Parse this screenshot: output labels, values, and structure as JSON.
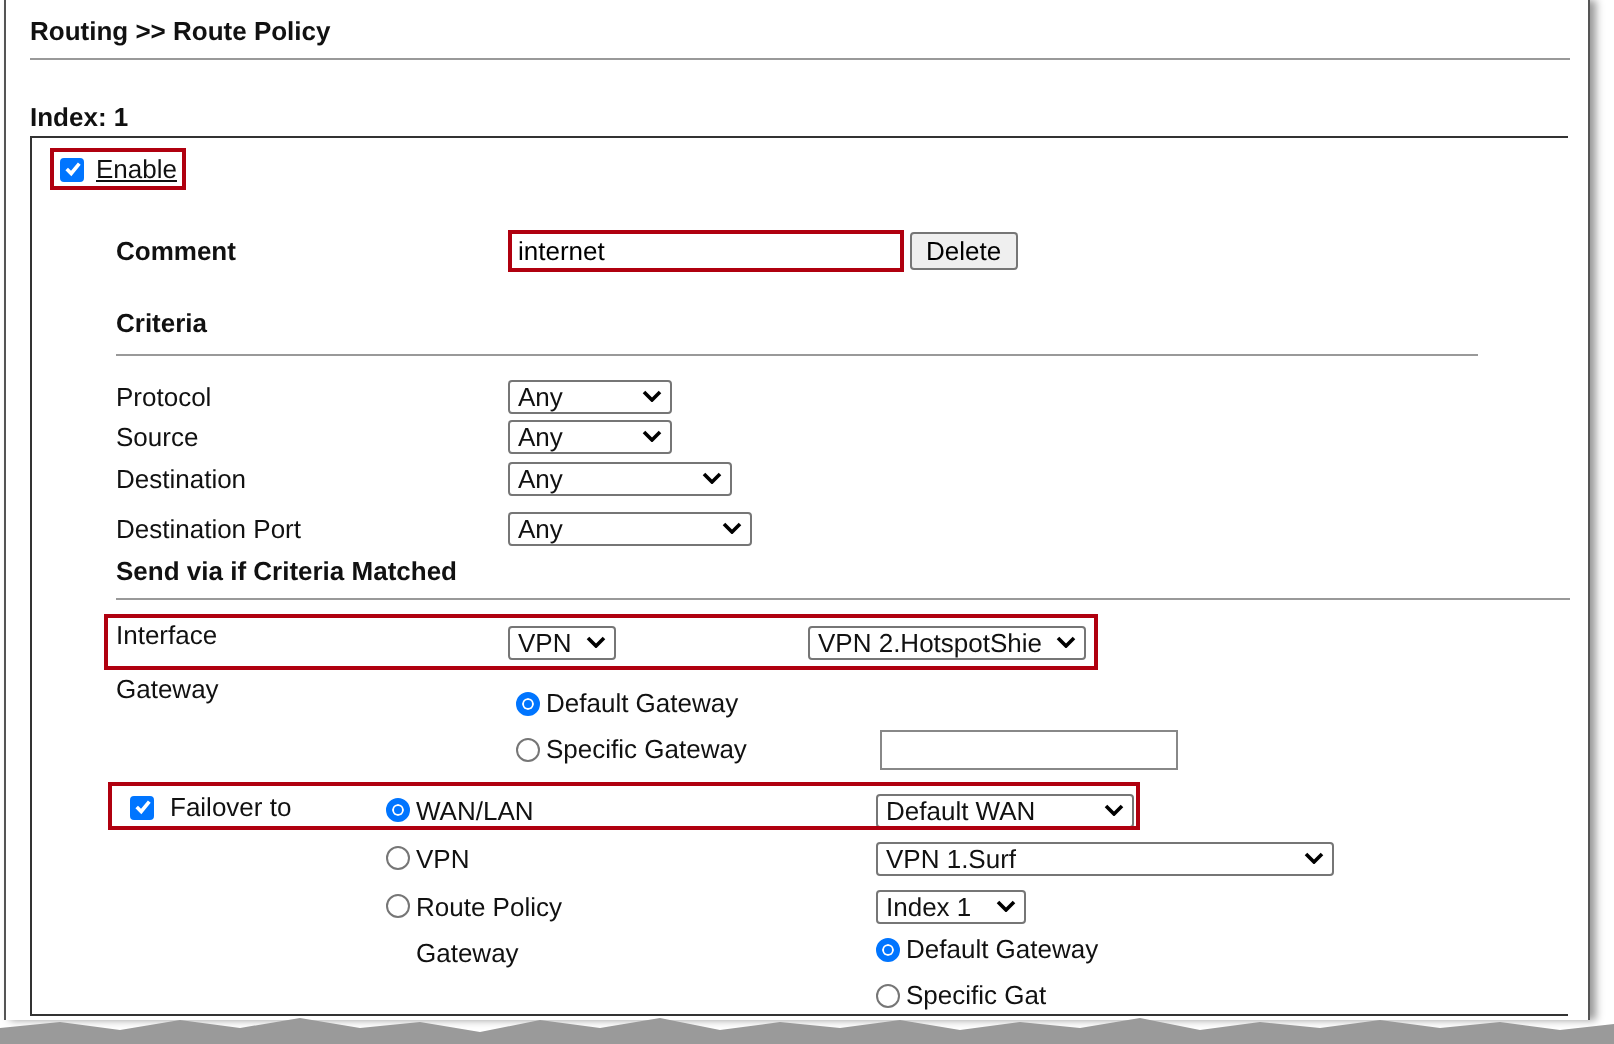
{
  "breadcrumb": "Routing >> Route Policy",
  "index_label": "Index: 1",
  "enable": {
    "label": "Enable",
    "checked": true,
    "highlighted": true
  },
  "comment": {
    "label": "Comment",
    "value": "internet",
    "button": "Delete",
    "highlighted": true
  },
  "criteria": {
    "heading": "Criteria",
    "fields": [
      {
        "label": "Protocol",
        "value": "Any"
      },
      {
        "label": "Source",
        "value": "Any"
      },
      {
        "label": "Destination",
        "value": "Any"
      },
      {
        "label": "Destination Port",
        "value": "Any"
      }
    ]
  },
  "send_via": {
    "heading": "Send via if Criteria Matched",
    "interface": {
      "label": "Interface",
      "type": "VPN",
      "target": "VPN 2.HotspotShie",
      "highlighted": true
    },
    "gateway": {
      "label": "Gateway",
      "options": [
        {
          "label": "Default Gateway",
          "selected": true
        },
        {
          "label": "Specific Gateway",
          "selected": false
        }
      ]
    },
    "failover": {
      "label": "Failover to",
      "checked": true,
      "highlighted": true,
      "options": [
        {
          "label": "WAN/LAN",
          "selected": true,
          "value": "Default WAN"
        },
        {
          "label": "VPN",
          "selected": false,
          "value": "VPN 1.Surf"
        },
        {
          "label": "Route Policy",
          "selected": false,
          "value": "Index 1"
        }
      ],
      "gateway": {
        "label": "Gateway",
        "options": [
          {
            "label": "Default Gateway",
            "selected": true
          },
          {
            "label": "Specific Gat",
            "selected": false
          }
        ]
      }
    }
  }
}
